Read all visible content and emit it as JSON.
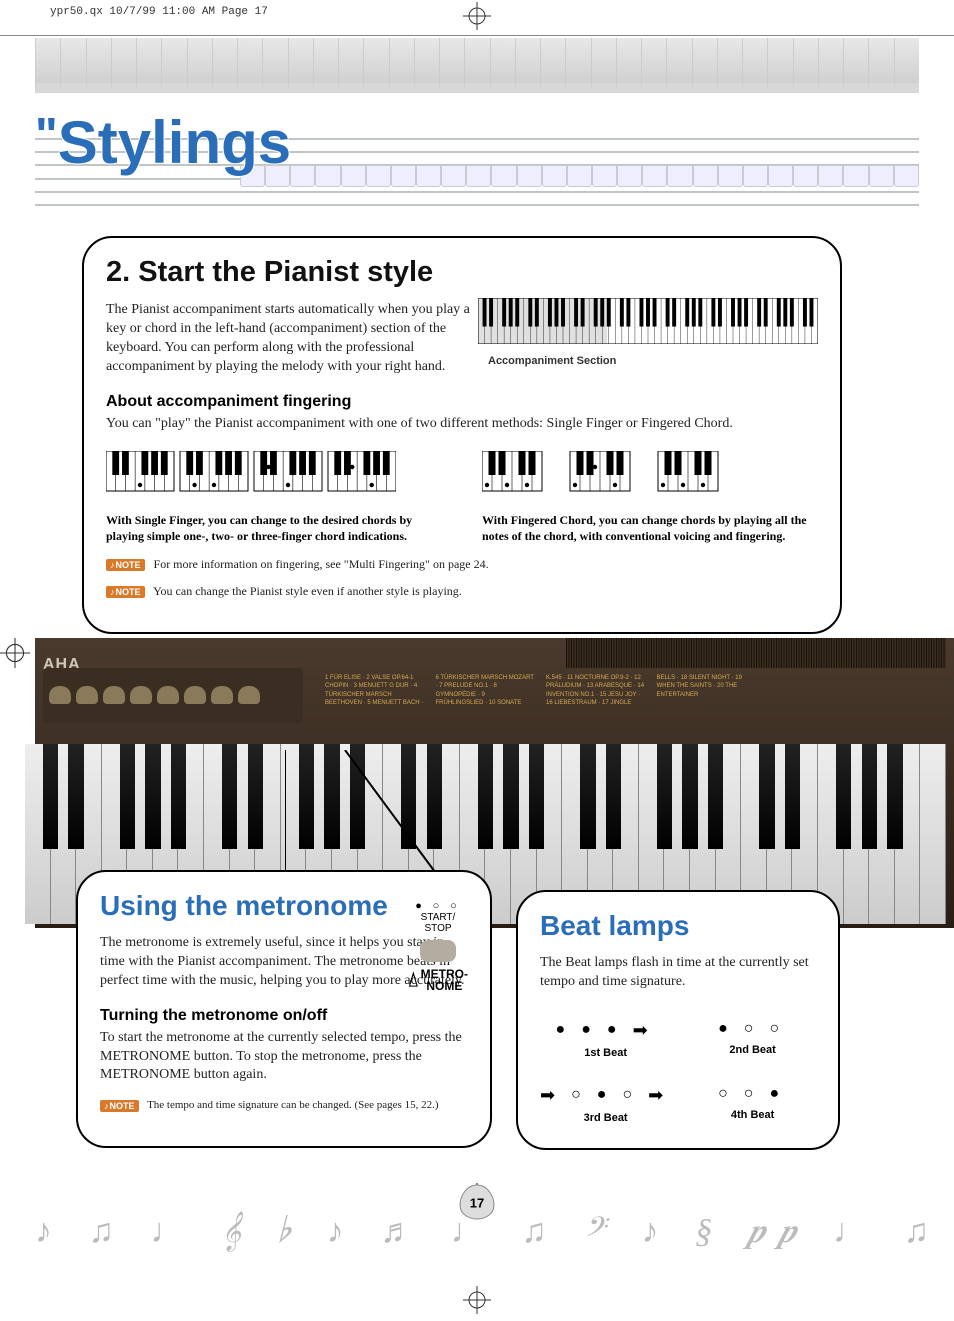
{
  "print": {
    "header": "ypr50.qx  10/7/99  11:00 AM  Page 17"
  },
  "header": {
    "title_prefix": "\"",
    "title": "Stylings"
  },
  "section_main": {
    "heading": "2. Start the Pianist style",
    "body": "The Pianist accompaniment starts automatically when you play a key or chord in the left-hand (accompaniment) section of the keyboard.  You can perform along with the professional accompaniment by playing the melody with your right hand.",
    "accomp_label": "Accompaniment Section",
    "sub_heading": "About accompaniment fingering",
    "sub_body": "You can \"play\" the Pianist accompaniment with one of two different methods: Single Finger or Fingered Chord.",
    "caption_single": "With Single Finger, you can change to the desired chords by playing simple one-, two- or three-finger chord indications.",
    "caption_fingered": "With Fingered Chord, you can change chords by playing all the notes of the chord, with conventional voicing and fingering.",
    "note1_badge": "NOTE",
    "note1": "For more information on fingering, see  \"Multi Fingering\" on page 24.",
    "note2_badge": "NOTE",
    "note2": "You can change the Pianist style even if another style is playing."
  },
  "photo": {
    "brand": "AHA",
    "song_list": "1 FÜR ELISE · 2 VALSE OP.64-1 CHOPIN · 3 MENUETT G DUR · 4 TÜRKISCHER MARSCH BEETHOVEN · 5 MENUETT BACH · 6 TÜRKISCHER MARSCH MOZART · 7 PRELUDE NO.1 · 8 GYMNOPÉDIE · 9 FRÜHLINGSLIED · 10 SONATE K.545 · 11 NOCTURNE OP.9-2 · 12 PRÄLUDIUM · 13 ARABESQUE · 14 INVENTION NO.1 · 15 JESU JOY · 16 LIEBESTRAUM · 17 JINGLE BELLS · 18 SILENT NIGHT · 19 WHEN THE SAINTS · 20 THE ENTERTAINER"
  },
  "section_metronome": {
    "heading": "Using the metronome",
    "body": "The metronome is extremely useful, since it helps you stay in time with the Pianist accompaniment.  The metronome beats in perfect time with the music, helping you to play more accurately.",
    "sub_heading": "Turning the metronome on/off",
    "sub_body": "To start the metronome at the currently selected tempo, press the METRONOME button.  To stop the metronome, press the METRONOME button again.",
    "note_badge": "NOTE",
    "note": "The tempo and time signature can be changed.  (See pages 15, 22.)",
    "button": {
      "start_stop": "START/\nSTOP",
      "metro_label": "METRO-\nNOME"
    }
  },
  "section_beat": {
    "heading": "Beat lamps",
    "body": "The Beat lamps flash in time at the currently set tempo and time signature.",
    "beats": {
      "b1": "1st Beat",
      "b2": "2nd Beat",
      "b3": "3rd Beat",
      "b4": "4th Beat"
    }
  },
  "page_number": "17"
}
